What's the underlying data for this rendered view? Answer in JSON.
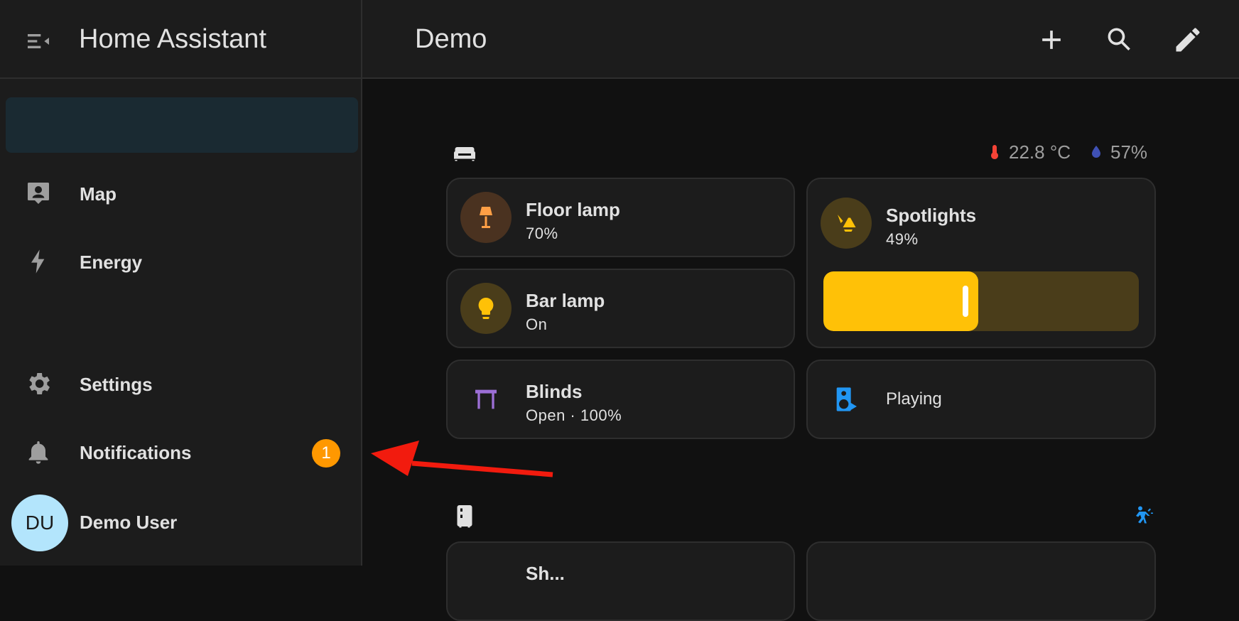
{
  "sidebar": {
    "title": "Home Assistant",
    "items": [
      {
        "label": "Map"
      },
      {
        "label": "Energy"
      },
      {
        "label": "Settings"
      },
      {
        "label": "Notifications",
        "badge": "1"
      }
    ],
    "user": {
      "initials": "DU",
      "name": "Demo User"
    }
  },
  "topbar": {
    "title": "Demo"
  },
  "area": {
    "temperature": "22.8 °C",
    "humidity": "57%"
  },
  "cards": {
    "floor_lamp": {
      "name": "Floor lamp",
      "state": "70%"
    },
    "bar_lamp": {
      "name": "Bar lamp",
      "state": "On"
    },
    "blinds": {
      "name": "Blinds",
      "state": "Open · 100%"
    },
    "spotlights": {
      "name": "Spotlights",
      "state": "49%",
      "brightness": 0.49
    },
    "media": {
      "state": "Playing"
    },
    "shutter": {
      "name": "Sh..."
    }
  },
  "colors": {
    "accent": "#ffc107",
    "badge": "#ff9800",
    "avatar": "#b3e5fc",
    "annotation_arrow": "#f21b0e"
  }
}
